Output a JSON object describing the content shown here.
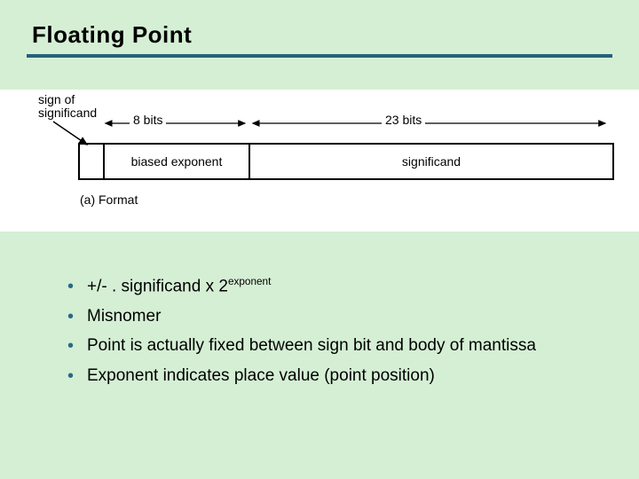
{
  "title": "Floating Point",
  "figure": {
    "sign_label_line1": "sign of",
    "sign_label_line2": "significand",
    "width_exponent_label": "8 bits",
    "width_significand_label": "23 bits",
    "cell_exponent": "biased exponent",
    "cell_significand": "significand",
    "caption": "(a) Format"
  },
  "bullets": {
    "b1_prefix": "+/- . significand x 2",
    "b1_sup": "exponent",
    "b2": "Misnomer",
    "b3": "Point is actually fixed between sign bit and body of mantissa",
    "b4": "Exponent indicates place value (point position)"
  }
}
